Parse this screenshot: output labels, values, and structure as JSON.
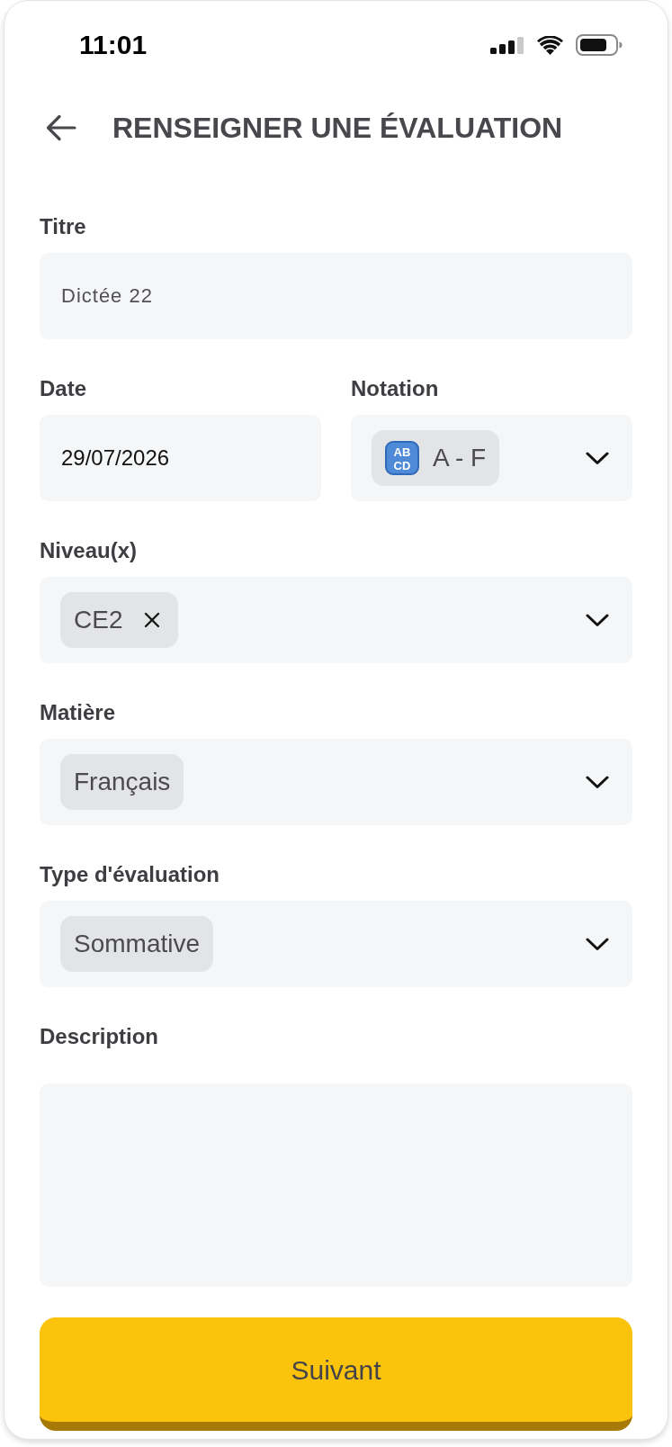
{
  "status_bar": {
    "time": "11:01"
  },
  "header": {
    "title": "RENSEIGNER UNE ÉVALUATION"
  },
  "title_field": {
    "label": "Titre",
    "value": "Dictée 22"
  },
  "date_field": {
    "label": "Date",
    "value": "29/07/2026"
  },
  "notation_select": {
    "label": "Notation",
    "chips": [
      {
        "icon_letters": [
          "AB",
          "CD"
        ],
        "text": "A - F",
        "removable": false
      }
    ]
  },
  "select_fields": [
    {
      "label": "Niveau(x)",
      "chips": [
        {
          "text": "CE2",
          "removable": true
        }
      ]
    },
    {
      "label": "Matière",
      "chips": [
        {
          "text": "Français",
          "removable": false
        }
      ]
    },
    {
      "label": "Type d'évaluation",
      "chips": [
        {
          "text": "Sommative",
          "removable": false
        }
      ]
    }
  ],
  "description_field": {
    "label": "Description"
  },
  "next_button": {
    "label": "Suivant"
  }
}
